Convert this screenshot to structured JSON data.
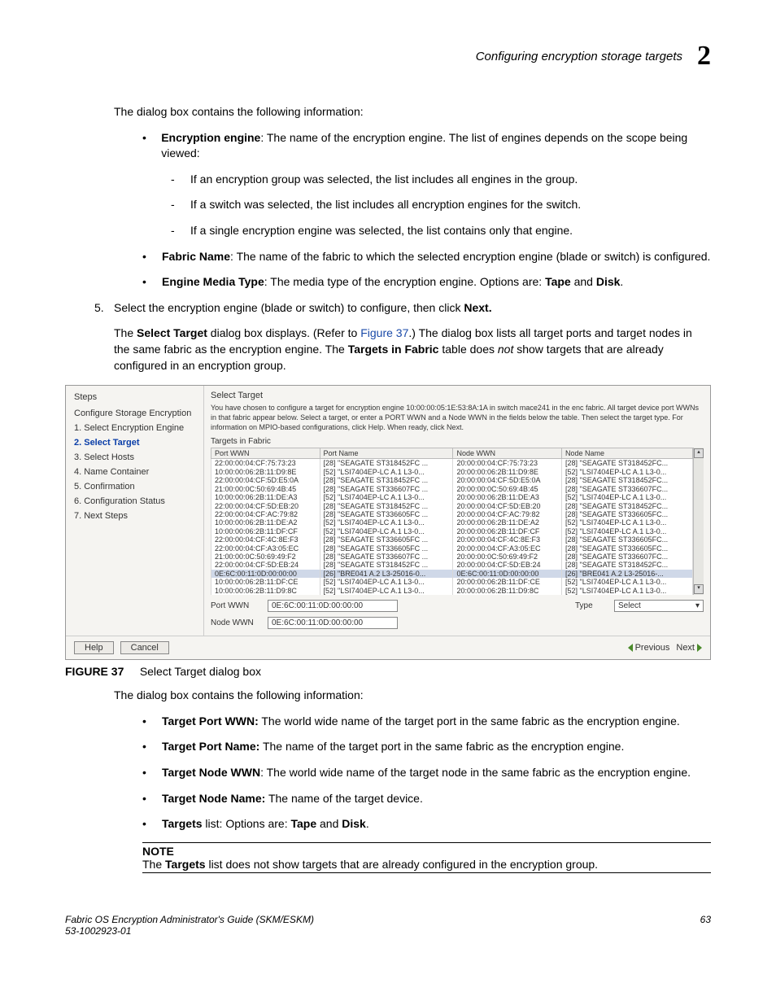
{
  "header": {
    "title": "Configuring encryption storage targets",
    "chapter": "2"
  },
  "intro1": "The dialog box contains the following information:",
  "bullets1": {
    "b1_label": "Encryption engine",
    "b1_text": ": The name of the encryption engine. The list of engines depends on the scope being viewed:",
    "d1": "If an encryption group was selected, the list includes all engines in the group.",
    "d2": "If a switch was selected, the list includes all encryption engines for the switch.",
    "d3": "If a single encryption engine was selected, the list contains only that engine.",
    "b2_label": "Fabric Name",
    "b2_text": ": The name of the fabric to which the selected encryption engine (blade or switch) is configured.",
    "b3_label": "Engine Media Type",
    "b3_text1": ": The media type of the encryption engine. Options are: ",
    "b3_tape": "Tape",
    "b3_and": " and ",
    "b3_disk": "Disk",
    "b3_dot": "."
  },
  "step5": {
    "num": "5.",
    "text1": "Select the encryption engine (blade or switch) to configure, then click ",
    "next": "Next.",
    "p2a": "The ",
    "p2b": "Select Target",
    "p2c": " dialog box displays. (Refer to ",
    "p2link": "Figure 37",
    "p2d": ".) The dialog box lists all target ports and target nodes in the same fabric as the encryption engine. The ",
    "p2e": "Targets in Fabric",
    "p2f": " table does ",
    "p2g": "not",
    "p2h": " show targets that are already configured in an encryption group."
  },
  "dialog": {
    "steps_title": "Steps",
    "steps_main": "Configure Storage Encryption",
    "steps": [
      "1. Select Encryption Engine",
      "2. Select Target",
      "3. Select Hosts",
      "4. Name Container",
      "5. Confirmation",
      "6. Configuration Status",
      "7. Next Steps"
    ],
    "target_title": "Select Target",
    "instructions": "You have chosen to configure a target for encryption engine 10:00:00:05:1E:53:8A:1A in switch mace241 in the enc fabric. All target device port WWNs in that fabric appear below. Select a target, or enter a PORT WWN and a Node WWN in the fields below the table. Then select the target type. For information on MPIO-based configurations, click Help. When ready, click Next.",
    "tif": "Targets in Fabric",
    "cols": {
      "c1": "Port WWN",
      "c2": "Port Name",
      "c3": "Node WWN",
      "c4": "Node Name"
    },
    "rows": [
      {
        "pw": "22:00:00:04:CF:75:73:23",
        "pn": "[28] \"SEAGATE ST318452FC ...",
        "nw": "20:00:00:04:CF:75:73:23",
        "nn": "[28] \"SEAGATE ST318452FC..."
      },
      {
        "pw": "10:00:00:06:2B:11:D9:8E",
        "pn": "[52] \"LSI7404EP-LC A.1 L3-0...",
        "nw": "20:00:00:06:2B:11:D9:8E",
        "nn": "[52] \"LSI7404EP-LC A.1 L3-0..."
      },
      {
        "pw": "22:00:00:04:CF:5D:E5:0A",
        "pn": "[28] \"SEAGATE ST318452FC ...",
        "nw": "20:00:00:04:CF:5D:E5:0A",
        "nn": "[28] \"SEAGATE ST318452FC..."
      },
      {
        "pw": "21:00:00:0C:50:69:4B:45",
        "pn": "[28] \"SEAGATE ST336607FC ...",
        "nw": "20:00:00:0C:50:69:4B:45",
        "nn": "[28] \"SEAGATE ST336607FC..."
      },
      {
        "pw": "10:00:00:06:2B:11:DE:A3",
        "pn": "[52] \"LSI7404EP-LC A.1 L3-0...",
        "nw": "20:00:00:06:2B:11:DE:A3",
        "nn": "[52] \"LSI7404EP-LC A.1 L3-0..."
      },
      {
        "pw": "22:00:00:04:CF:5D:EB:20",
        "pn": "[28] \"SEAGATE ST318452FC ...",
        "nw": "20:00:00:04:CF:5D:EB:20",
        "nn": "[28] \"SEAGATE ST318452FC..."
      },
      {
        "pw": "22:00:00:04:CF:AC:79:82",
        "pn": "[28] \"SEAGATE ST336605FC ...",
        "nw": "20:00:00:04:CF:AC:79:82",
        "nn": "[28] \"SEAGATE ST336605FC..."
      },
      {
        "pw": "10:00:00:06:2B:11:DE:A2",
        "pn": "[52] \"LSI7404EP-LC A.1 L3-0...",
        "nw": "20:00:00:06:2B:11:DE:A2",
        "nn": "[52] \"LSI7404EP-LC A.1 L3-0..."
      },
      {
        "pw": "10:00:00:06:2B:11:DF:CF",
        "pn": "[52] \"LSI7404EP-LC A.1 L3-0...",
        "nw": "20:00:00:06:2B:11:DF:CF",
        "nn": "[52] \"LSI7404EP-LC A.1 L3-0..."
      },
      {
        "pw": "22:00:00:04:CF:4C:8E:F3",
        "pn": "[28] \"SEAGATE ST336605FC ...",
        "nw": "20:00:00:04:CF:4C:8E:F3",
        "nn": "[28] \"SEAGATE ST336605FC..."
      },
      {
        "pw": "22:00:00:04:CF:A3:05:EC",
        "pn": "[28] \"SEAGATE ST336605FC ...",
        "nw": "20:00:00:04:CF:A3:05:EC",
        "nn": "[28] \"SEAGATE ST336605FC..."
      },
      {
        "pw": "21:00:00:0C:50:69:49:F2",
        "pn": "[28] \"SEAGATE ST336607FC ...",
        "nw": "20:00:00:0C:50:69:49:F2",
        "nn": "[28] \"SEAGATE ST336607FC..."
      },
      {
        "pw": "22:00:00:04:CF:5D:EB:24",
        "pn": "[28] \"SEAGATE ST318452FC ...",
        "nw": "20:00:00:04:CF:5D:EB:24",
        "nn": "[28] \"SEAGATE ST318452FC..."
      },
      {
        "pw": "0E:6C:00:11:0D:00:00:00",
        "pn": "[26] \"BRE041 A.2 L3-25016-0...",
        "nw": "0E:6C:00:11:0D:00:00:00",
        "nn": "[26] \"BRE041 A.2 L3-25016-...",
        "sel": true
      },
      {
        "pw": "10:00:00:06:2B:11:DF:CE",
        "pn": "[52] \"LSI7404EP-LC A.1 L3-0...",
        "nw": "20:00:00:06:2B:11:DF:CE",
        "nn": "[52] \"LSI7404EP-LC A.1 L3-0..."
      },
      {
        "pw": "10:00:00:06:2B:11:D9:8C",
        "pn": "[52] \"LSI7404EP-LC A.1 L3-0...",
        "nw": "20:00:00:06:2B:11:D9:8C",
        "nn": "[52] \"LSI7404EP-LC A.1 L3-0..."
      }
    ],
    "port_wwn_label": "Port WWN",
    "port_wwn_value": "0E:6C:00:11:0D:00:00:00",
    "node_wwn_label": "Node WWN",
    "node_wwn_value": "0E:6C:00:11:0D:00:00:00",
    "type_label": "Type",
    "type_value": "Select",
    "help": "Help",
    "cancel": "Cancel",
    "prev": "Previous",
    "next": "Next"
  },
  "figcap": {
    "label": "FIGURE 37",
    "text": "Select Target dialog box"
  },
  "intro2": "The dialog box contains the following information:",
  "bullets2": {
    "b1l": "Target Port WWN:",
    "b1t": " The world wide name of the target port in the same fabric as the encryption engine.",
    "b2l": "Target Port Name:",
    "b2t": " The name of the target port in the same fabric as the encryption engine.",
    "b3l": "Target Node WWN",
    "b3t": ": The world wide name of the target node in the same fabric as the encryption engine.",
    "b4l": "Target Node Name:",
    "b4t": " The name of the target device.",
    "b5l": "Targets",
    "b5t1": " list: Options are: ",
    "b5tape": "Tape",
    "b5and": " and ",
    "b5disk": "Disk",
    "b5dot": "."
  },
  "note": {
    "title": "NOTE",
    "t1": "The ",
    "t2": "Targets",
    "t3": " list does not show targets that are already configured in the encryption group."
  },
  "footer": {
    "left1": "Fabric OS Encryption Administrator's Guide (SKM/ESKM)",
    "left2": "53-1002923-01",
    "right": "63"
  }
}
